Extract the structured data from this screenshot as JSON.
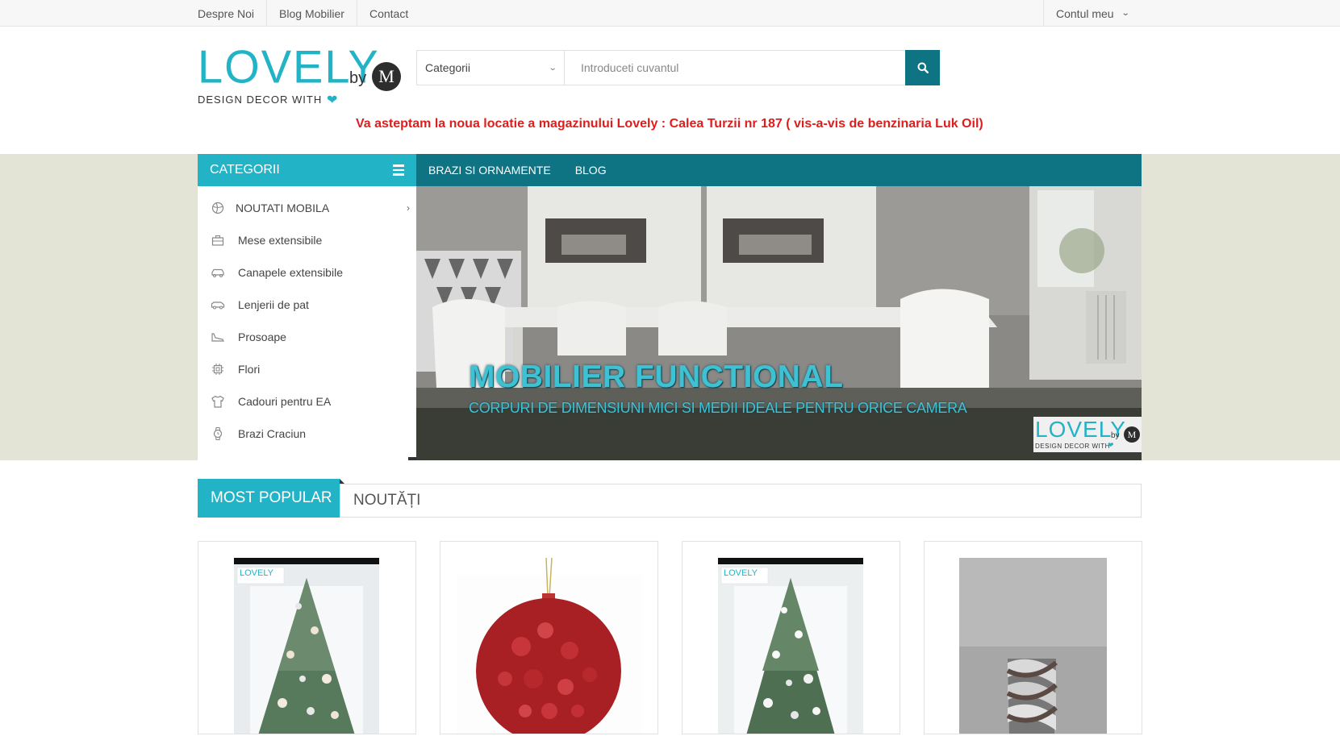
{
  "topbar": {
    "links": [
      "Despre Noi",
      "Blog Mobilier",
      "Contact"
    ],
    "account_label": "Contul meu"
  },
  "logo": {
    "word": "LOVELY",
    "by": "by",
    "mark": "M",
    "tagline": "DESIGN DECOR WITH",
    "heart_icon": "heart-icon"
  },
  "search": {
    "category_value": "Categorii",
    "placeholder": "Introduceti cuvantul",
    "button_icon": "search-icon"
  },
  "notice": "Va asteptam la noua locatie a magazinului Lovely : Calea Turzii nr 187 ( vis-a-vis de benzinaria Luk Oil)",
  "categories": {
    "title": "CATEGORII",
    "items": [
      {
        "label": "NOUTATI MOBILA",
        "icon": "basketball-icon"
      },
      {
        "label": "Mese extensibile",
        "icon": "briefcase-icon"
      },
      {
        "label": "Canapele extensibile",
        "icon": "car-icon"
      },
      {
        "label": "Lenjerii de pat",
        "icon": "bus-icon"
      },
      {
        "label": "Prosoape",
        "icon": "shoe-icon"
      },
      {
        "label": "Flori",
        "icon": "chip-icon"
      },
      {
        "label": "Cadouri pentru EA",
        "icon": "tshirt-icon"
      },
      {
        "label": "Brazi Craciun",
        "icon": "watch-icon"
      }
    ]
  },
  "menu": {
    "items": [
      "BRAZI SI ORNAMENTE",
      "BLOG"
    ]
  },
  "slider": {
    "title": "MOBILIER FUNCTIONAL",
    "subtitle": "CORPURI DE DIMENSIUNI MICI SI MEDII IDEALE PENTRU ORICE CAMERA",
    "logo_word": "LOVELY",
    "logo_by": "by",
    "logo_mark": "M",
    "logo_tagline": "DESIGN DECOR WITH"
  },
  "tabs": {
    "active": "MOST POPULAR",
    "other": "NOUTĂȚI"
  },
  "products": [
    {
      "name": "silver-christmas-tree",
      "logo_word": "LOVELY"
    },
    {
      "name": "red-bauble-ornament"
    },
    {
      "name": "white-christmas-tree",
      "logo_word": "LOVELY"
    },
    {
      "name": "twisted-metal-vase"
    }
  ],
  "colors": {
    "accent": "#22b3c7",
    "menu_dark": "#0e7383",
    "notice_red": "#e01d1d",
    "band_bg": "#e3e3d6"
  }
}
